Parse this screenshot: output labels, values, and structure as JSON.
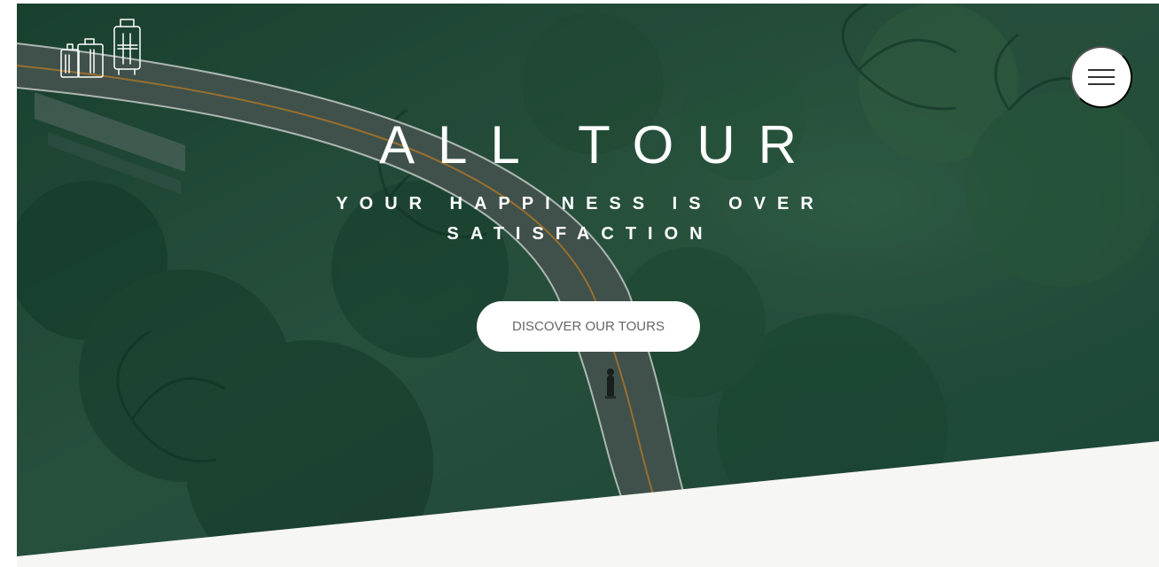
{
  "site": {
    "logo": "luggage-logo-icon",
    "menu_icon": "hamburger-menu-icon"
  },
  "hero": {
    "title": "ALL TOUR",
    "subtitle": "YOUR HAPPINESS IS OVER SATISFACTION",
    "cta_label": "DISCOVER OUR TOURS"
  },
  "colors": {
    "hero_overlay": "#214a38",
    "button_bg": "#ffffff",
    "button_text": "#666666",
    "bottom_panel": "#f6f6f3"
  }
}
